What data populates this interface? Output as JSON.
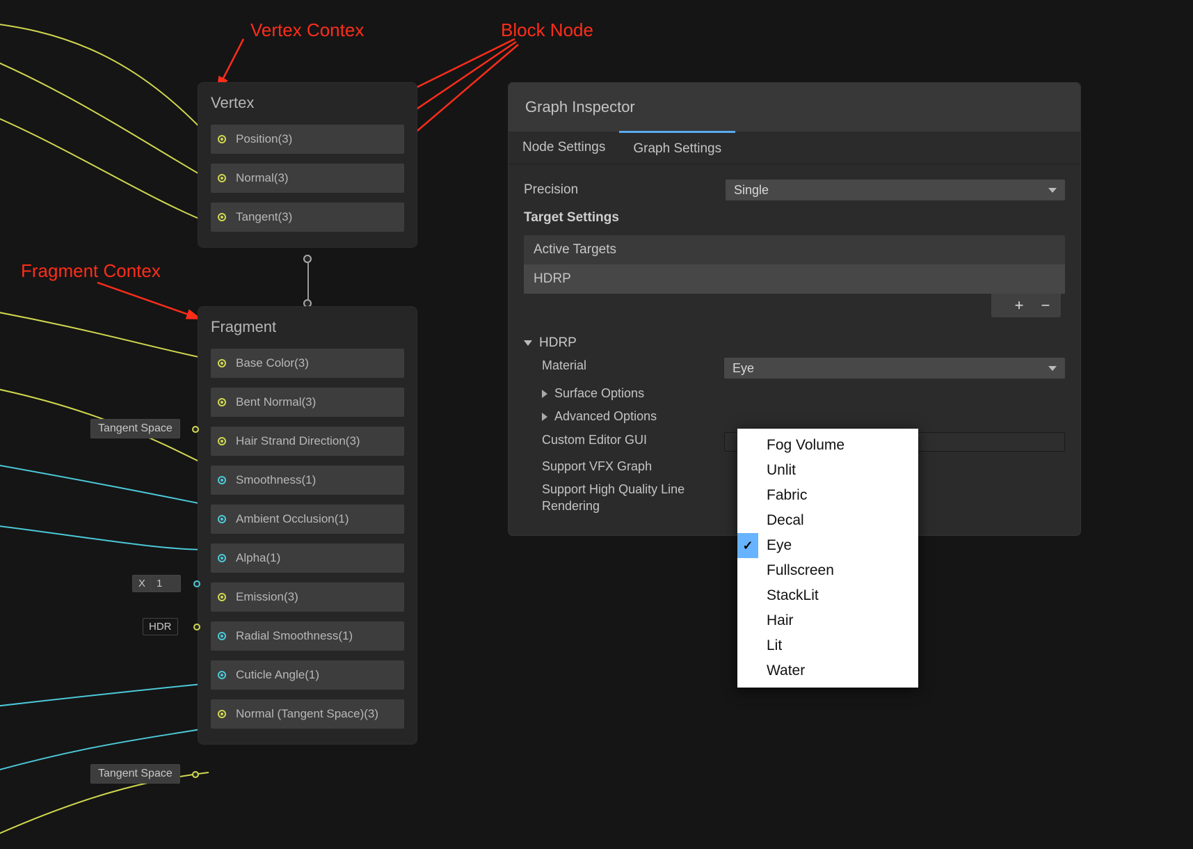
{
  "annotations": {
    "vertex_ctx": "Vertex Contex",
    "block_node": "Block Node",
    "fragment_ctx": "Fragment Contex"
  },
  "vertex": {
    "title": "Vertex",
    "blocks": [
      {
        "label": "Position(3)",
        "portColor": "yellow"
      },
      {
        "label": "Normal(3)",
        "portColor": "yellow"
      },
      {
        "label": "Tangent(3)",
        "portColor": "yellow"
      }
    ]
  },
  "fragment": {
    "title": "Fragment",
    "blocks": [
      {
        "label": "Base Color(3)",
        "portColor": "yellow"
      },
      {
        "label": "Bent Normal(3)",
        "portColor": "yellow"
      },
      {
        "label": "Hair Strand Direction(3)",
        "portColor": "yellow"
      },
      {
        "label": "Smoothness(1)",
        "portColor": "cyan"
      },
      {
        "label": "Ambient Occlusion(1)",
        "portColor": "cyan"
      },
      {
        "label": "Alpha(1)",
        "portColor": "cyan"
      },
      {
        "label": "Emission(3)",
        "portColor": "yellow"
      },
      {
        "label": "Radial Smoothness(1)",
        "portColor": "cyan"
      },
      {
        "label": "Cuticle Angle(1)",
        "portColor": "cyan"
      },
      {
        "label": "Normal (Tangent Space)(3)",
        "portColor": "yellow"
      }
    ]
  },
  "chips": {
    "tangent_space": "Tangent Space",
    "x_label": "X",
    "x_value": "1",
    "hdr": "HDR"
  },
  "inspector": {
    "title": "Graph Inspector",
    "tabs": {
      "node": "Node Settings",
      "graph": "Graph Settings"
    },
    "precision": {
      "label": "Precision",
      "value": "Single"
    },
    "target_settings": "Target Settings",
    "active_targets": "Active Targets",
    "targets": [
      "HDRP"
    ],
    "plus": "+",
    "minus": "−",
    "section": "HDRP",
    "material": {
      "label": "Material",
      "value": "Eye"
    },
    "surface_options": "Surface Options",
    "advanced_options": "Advanced Options",
    "custom_gui": "Custom Editor GUI",
    "support_vfx": "Support VFX Graph",
    "support_hqlr": "Support High Quality Line Rendering"
  },
  "material_menu": {
    "selected": "Eye",
    "items": [
      "Fog Volume",
      "Unlit",
      "Fabric",
      "Decal",
      "Eye",
      "Fullscreen",
      "StackLit",
      "Hair",
      "Lit",
      "Water"
    ]
  }
}
